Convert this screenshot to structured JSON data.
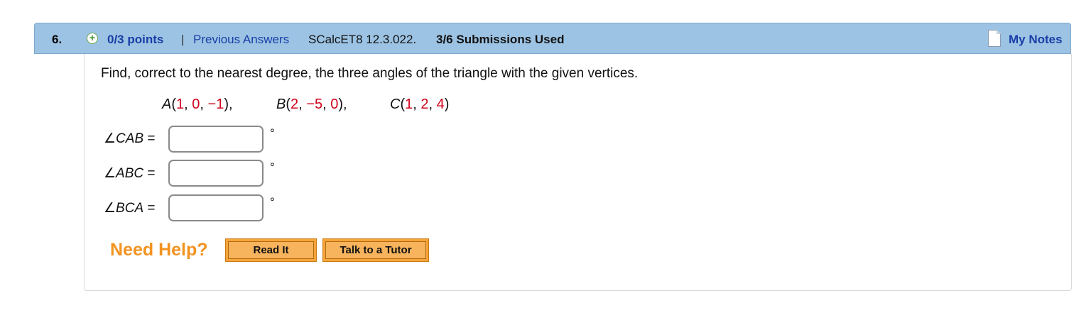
{
  "header": {
    "question_number": "6.",
    "plus_icon": "+",
    "points": "0/3 points",
    "separator": "|",
    "previous_answers": "Previous Answers",
    "code": "SCalcET8 12.3.022.",
    "submissions": "3/6 Submissions Used",
    "my_notes": "My Notes"
  },
  "question": {
    "prompt": "Find, correct to the nearest degree, the three angles of the triangle with the given vertices.",
    "vertices": [
      {
        "name": "A",
        "open": "(",
        "coords": [
          "1",
          "0",
          "−1"
        ],
        "close": "),"
      },
      {
        "name": "B",
        "open": "(",
        "coords": [
          "2",
          "−5",
          "0"
        ],
        "close": "),"
      },
      {
        "name": "C",
        "open": "(",
        "coords": [
          "1",
          "2",
          "4"
        ],
        "close": ")"
      }
    ],
    "comma": ", "
  },
  "answers": [
    {
      "angle_symbol": "∠",
      "label": "CAB",
      "equals": " =",
      "value": "",
      "unit": "°"
    },
    {
      "angle_symbol": "∠",
      "label": "ABC",
      "equals": " =",
      "value": "",
      "unit": "°"
    },
    {
      "angle_symbol": "∠",
      "label": "BCA",
      "equals": " =",
      "value": "",
      "unit": "°"
    }
  ],
  "help": {
    "need_help": "Need Help?",
    "read_it": "Read It",
    "talk_to_tutor": "Talk to a Tutor"
  },
  "colors": {
    "header_bg": "#9cc3e3",
    "link": "#1a3ea6",
    "value_red": "#d0021b",
    "need_help_orange": "#f29321",
    "button_orange": "#f7a43a"
  },
  "icons": {
    "plus_icon": "add-circle-icon",
    "notes_icon": "note-page-icon"
  }
}
